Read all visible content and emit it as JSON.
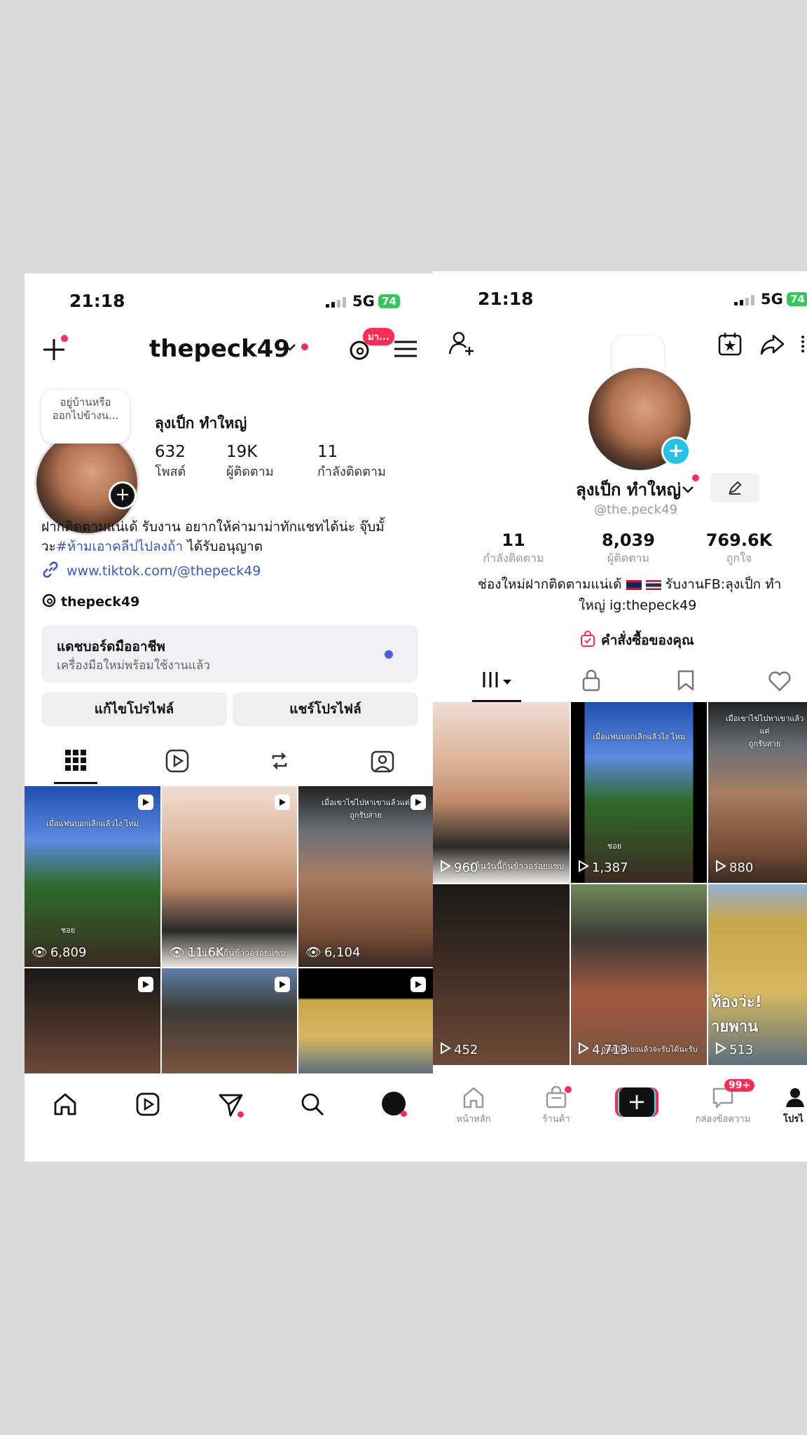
{
  "instagram": {
    "status_bar": {
      "time": "21:18",
      "network": "5G",
      "battery": "74"
    },
    "header": {
      "username": "thepeck49",
      "threads_badge": "มา..."
    },
    "note_bubble": "อยู่บ้านหรือ\nออกไปข้างน...",
    "display_name": "ลุงเป็ก ทำใหญ่",
    "stats": [
      {
        "count": "632",
        "label": "โพสต์"
      },
      {
        "count": "19K",
        "label": "ผู้ติดตาม"
      },
      {
        "count": "11",
        "label": "กำลังติดตาม"
      }
    ],
    "bio_line1": "ฝากติดตามแน่เด้ รับงาน อยากให้ค่ามาม่าทักแชทได้น่ะ จุ๊บมั้",
    "bio_line2_prefix": "วะ",
    "bio_hashtag": "#ห้ามเอาคลีปไปลงถ้า",
    "bio_line2_suffix": " ได้รับอนุญาต",
    "link": "www.tiktok.com/@thepeck49",
    "threads_handle": "thepeck49",
    "dashboard": {
      "title": "แดชบอร์ดมืออาชีพ",
      "subtitle": "เครื่องมือใหม่พร้อมใช้งานแล้ว",
      "dot_color": "#4a5ce0"
    },
    "buttons": {
      "edit": "แก้ไขโปรไฟล์",
      "share": "แชร์โปรไฟล์"
    },
    "tabs": [
      "grid-icon",
      "reels-icon",
      "reposts-icon",
      "tagged-icon"
    ],
    "grid": [
      {
        "views": "6,809",
        "caption_top": "เมื่อแฟนบอกเลิกแล้วไง ไหม",
        "caption_mid": "ชอย"
      },
      {
        "views": "11.6K",
        "caption_bottom": "ดูเห็นวันนี้กินข้าวอร่อยแซบ"
      },
      {
        "views": "6,104",
        "caption_top": "เมื่อเขาไข่ไปหาเขาแล้วแต่\nถูกรับสาย"
      },
      {
        "views": ""
      },
      {
        "views": ""
      },
      {
        "views": ""
      }
    ],
    "bottom_nav": [
      "home-icon",
      "reels-icon",
      "send-icon",
      "search-icon",
      "profile-icon"
    ]
  },
  "tiktok": {
    "status_bar": {
      "time": "21:18",
      "network": "5G",
      "battery": "74"
    },
    "display_name": "ลุงเป็ก ทำใหญ่",
    "handle": "@the.peck49",
    "stats": [
      {
        "count": "11",
        "label": "กำลังติดตาม"
      },
      {
        "count": "8,039",
        "label": "ผู้ติดตาม"
      },
      {
        "count": "769.6K",
        "label": "ถูกใจ"
      }
    ],
    "bio_line1_a": "ช่องใหม่ฝากติดตามแน่เด้",
    "bio_line1_b": "รับงานFB:ลุงเป็ก ทำ",
    "bio_line2": "ใหญ่ ig:thepeck49",
    "orders": "คำสั่งซื้อของคุณ",
    "grid": [
      {
        "views": "960",
        "caption_bottom": "ดูเห็นวันนี้กินข้าวอร่อยแซบ"
      },
      {
        "views": "1,387",
        "caption_top": "เมื่อแฟนบอกเลิกแล้วไง ไหม",
        "caption_mid": "ชอย"
      },
      {
        "views": "880",
        "caption_top": "เมื่อเขาไข่ไปหาเขาแล้วแต่\nถูกรับสาย"
      },
      {
        "views": "452"
      },
      {
        "views": "4,713",
        "caption_bottom": "ถูกสบัดแยงแล้วจะรับได้นะรับ"
      },
      {
        "views": "513",
        "caption_mid": "ท้องว่ะ!\nายพาน"
      }
    ],
    "bottom_nav": {
      "home": "หน้าหลัก",
      "shop": "ร้านค้า",
      "inbox": "กล่องข้อความ",
      "inbox_badge": "99+",
      "profile": "โปรไ"
    }
  }
}
